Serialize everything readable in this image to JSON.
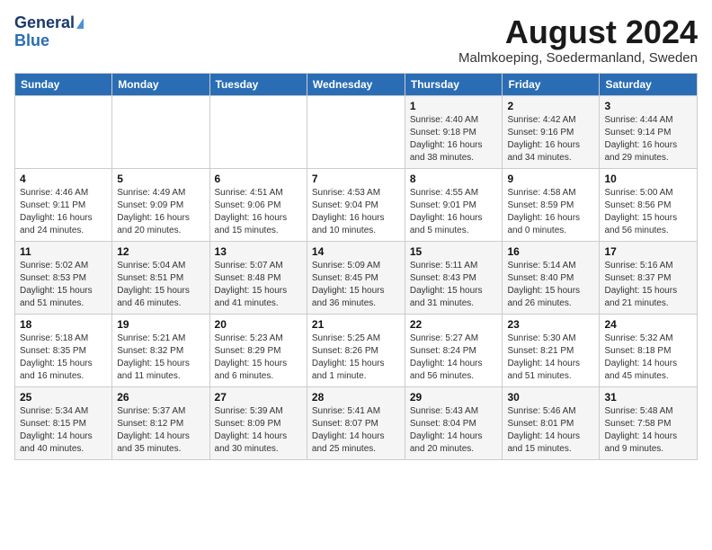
{
  "header": {
    "logo_line1": "General",
    "logo_line2": "Blue",
    "month": "August 2024",
    "location": "Malmkoeping, Soedermanland, Sweden"
  },
  "days_of_week": [
    "Sunday",
    "Monday",
    "Tuesday",
    "Wednesday",
    "Thursday",
    "Friday",
    "Saturday"
  ],
  "weeks": [
    [
      {
        "day": "",
        "info": ""
      },
      {
        "day": "",
        "info": ""
      },
      {
        "day": "",
        "info": ""
      },
      {
        "day": "",
        "info": ""
      },
      {
        "day": "1",
        "info": "Sunrise: 4:40 AM\nSunset: 9:18 PM\nDaylight: 16 hours\nand 38 minutes."
      },
      {
        "day": "2",
        "info": "Sunrise: 4:42 AM\nSunset: 9:16 PM\nDaylight: 16 hours\nand 34 minutes."
      },
      {
        "day": "3",
        "info": "Sunrise: 4:44 AM\nSunset: 9:14 PM\nDaylight: 16 hours\nand 29 minutes."
      }
    ],
    [
      {
        "day": "4",
        "info": "Sunrise: 4:46 AM\nSunset: 9:11 PM\nDaylight: 16 hours\nand 24 minutes."
      },
      {
        "day": "5",
        "info": "Sunrise: 4:49 AM\nSunset: 9:09 PM\nDaylight: 16 hours\nand 20 minutes."
      },
      {
        "day": "6",
        "info": "Sunrise: 4:51 AM\nSunset: 9:06 PM\nDaylight: 16 hours\nand 15 minutes."
      },
      {
        "day": "7",
        "info": "Sunrise: 4:53 AM\nSunset: 9:04 PM\nDaylight: 16 hours\nand 10 minutes."
      },
      {
        "day": "8",
        "info": "Sunrise: 4:55 AM\nSunset: 9:01 PM\nDaylight: 16 hours\nand 5 minutes."
      },
      {
        "day": "9",
        "info": "Sunrise: 4:58 AM\nSunset: 8:59 PM\nDaylight: 16 hours\nand 0 minutes."
      },
      {
        "day": "10",
        "info": "Sunrise: 5:00 AM\nSunset: 8:56 PM\nDaylight: 15 hours\nand 56 minutes."
      }
    ],
    [
      {
        "day": "11",
        "info": "Sunrise: 5:02 AM\nSunset: 8:53 PM\nDaylight: 15 hours\nand 51 minutes."
      },
      {
        "day": "12",
        "info": "Sunrise: 5:04 AM\nSunset: 8:51 PM\nDaylight: 15 hours\nand 46 minutes."
      },
      {
        "day": "13",
        "info": "Sunrise: 5:07 AM\nSunset: 8:48 PM\nDaylight: 15 hours\nand 41 minutes."
      },
      {
        "day": "14",
        "info": "Sunrise: 5:09 AM\nSunset: 8:45 PM\nDaylight: 15 hours\nand 36 minutes."
      },
      {
        "day": "15",
        "info": "Sunrise: 5:11 AM\nSunset: 8:43 PM\nDaylight: 15 hours\nand 31 minutes."
      },
      {
        "day": "16",
        "info": "Sunrise: 5:14 AM\nSunset: 8:40 PM\nDaylight: 15 hours\nand 26 minutes."
      },
      {
        "day": "17",
        "info": "Sunrise: 5:16 AM\nSunset: 8:37 PM\nDaylight: 15 hours\nand 21 minutes."
      }
    ],
    [
      {
        "day": "18",
        "info": "Sunrise: 5:18 AM\nSunset: 8:35 PM\nDaylight: 15 hours\nand 16 minutes."
      },
      {
        "day": "19",
        "info": "Sunrise: 5:21 AM\nSunset: 8:32 PM\nDaylight: 15 hours\nand 11 minutes."
      },
      {
        "day": "20",
        "info": "Sunrise: 5:23 AM\nSunset: 8:29 PM\nDaylight: 15 hours\nand 6 minutes."
      },
      {
        "day": "21",
        "info": "Sunrise: 5:25 AM\nSunset: 8:26 PM\nDaylight: 15 hours\nand 1 minute."
      },
      {
        "day": "22",
        "info": "Sunrise: 5:27 AM\nSunset: 8:24 PM\nDaylight: 14 hours\nand 56 minutes."
      },
      {
        "day": "23",
        "info": "Sunrise: 5:30 AM\nSunset: 8:21 PM\nDaylight: 14 hours\nand 51 minutes."
      },
      {
        "day": "24",
        "info": "Sunrise: 5:32 AM\nSunset: 8:18 PM\nDaylight: 14 hours\nand 45 minutes."
      }
    ],
    [
      {
        "day": "25",
        "info": "Sunrise: 5:34 AM\nSunset: 8:15 PM\nDaylight: 14 hours\nand 40 minutes."
      },
      {
        "day": "26",
        "info": "Sunrise: 5:37 AM\nSunset: 8:12 PM\nDaylight: 14 hours\nand 35 minutes."
      },
      {
        "day": "27",
        "info": "Sunrise: 5:39 AM\nSunset: 8:09 PM\nDaylight: 14 hours\nand 30 minutes."
      },
      {
        "day": "28",
        "info": "Sunrise: 5:41 AM\nSunset: 8:07 PM\nDaylight: 14 hours\nand 25 minutes."
      },
      {
        "day": "29",
        "info": "Sunrise: 5:43 AM\nSunset: 8:04 PM\nDaylight: 14 hours\nand 20 minutes."
      },
      {
        "day": "30",
        "info": "Sunrise: 5:46 AM\nSunset: 8:01 PM\nDaylight: 14 hours\nand 15 minutes."
      },
      {
        "day": "31",
        "info": "Sunrise: 5:48 AM\nSunset: 7:58 PM\nDaylight: 14 hours\nand 9 minutes."
      }
    ]
  ]
}
